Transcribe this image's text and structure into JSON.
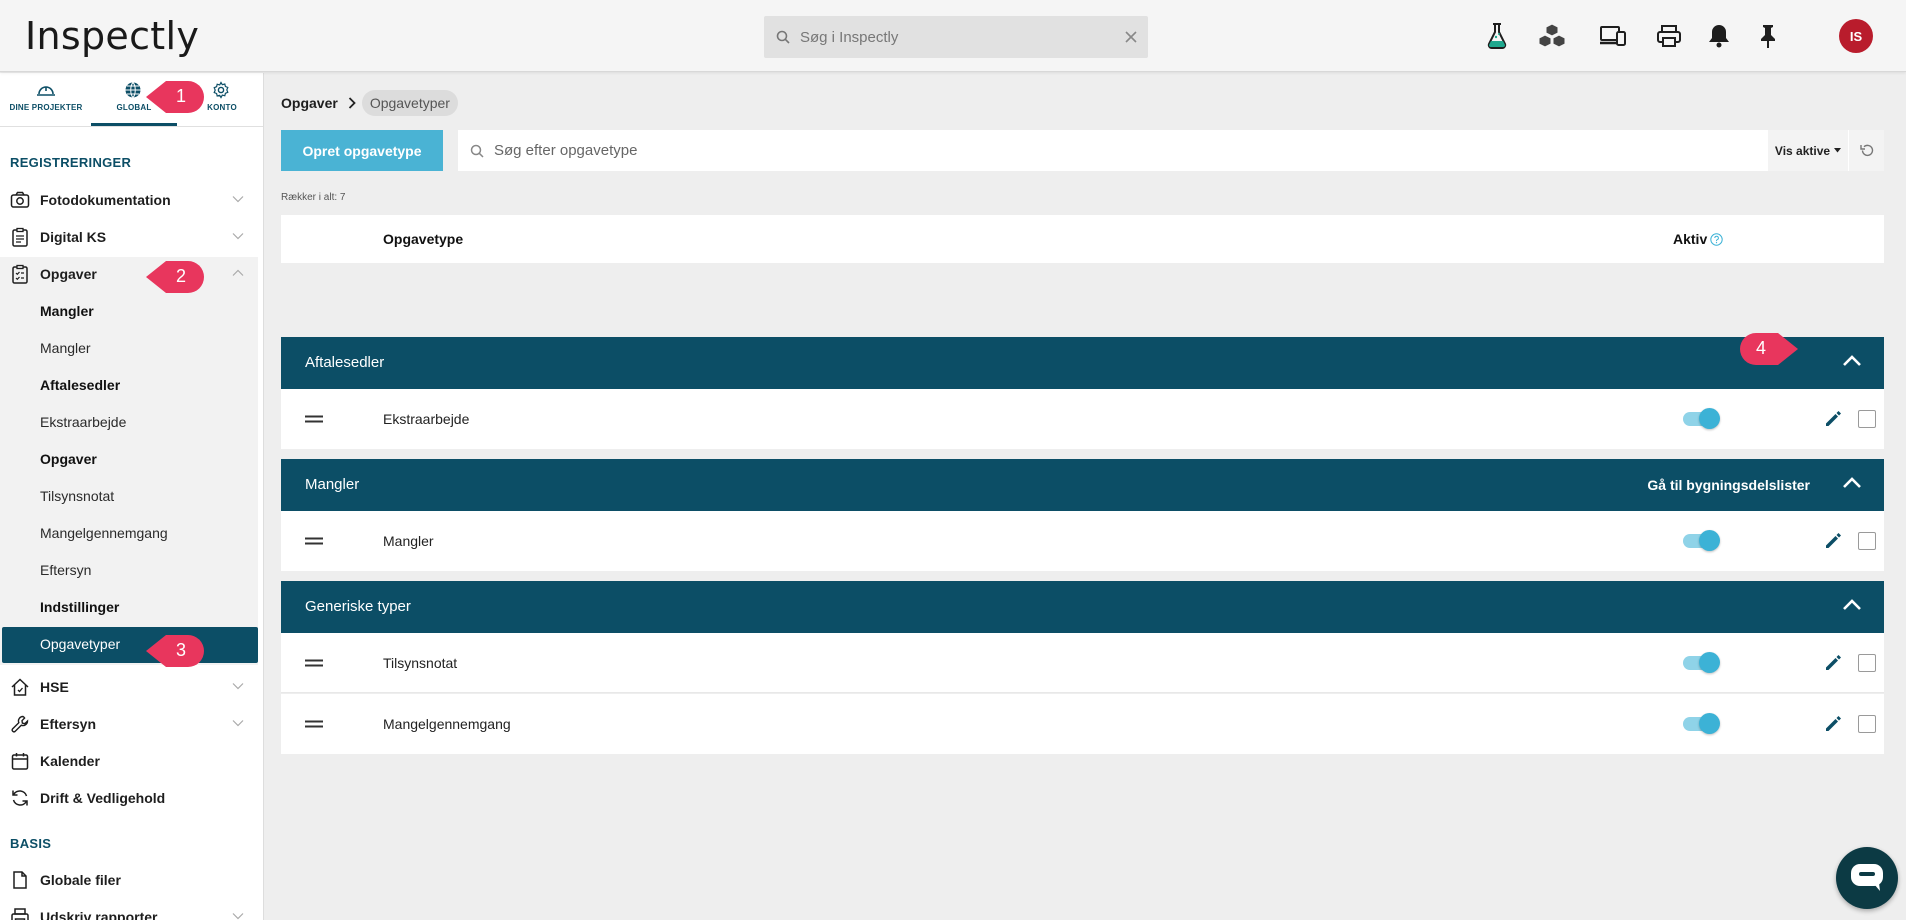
{
  "app": {
    "logo_text": "Inspectly"
  },
  "header": {
    "search_placeholder": "Søg i Inspectly",
    "avatar_initials": "IS",
    "icons": [
      "flask-icon",
      "cubes-icon",
      "devices-icon",
      "print-icon",
      "bell-icon",
      "pin-icon"
    ]
  },
  "sidebar": {
    "tabs": [
      {
        "label": "DINE PROJEKTER",
        "icon": "helmet-icon"
      },
      {
        "label": "GLOBAL",
        "icon": "globe-icon"
      },
      {
        "label": "KONTO",
        "icon": "gear-icon"
      }
    ],
    "sections": {
      "registreringer": "REGISTRERINGER",
      "basis": "BASIS"
    },
    "items": {
      "fotodokumentation": "Fotodokumentation",
      "digital_ks": "Digital KS",
      "opgaver": "Opgaver",
      "hse": "HSE",
      "eftersyn": "Eftersyn",
      "kalender": "Kalender",
      "drift": "Drift & Vedligehold",
      "globale_filer": "Globale filer",
      "udskriv_rapporter": "Udskriv rapporter"
    },
    "opgaver_sub": [
      {
        "label": "Mangler",
        "bold": true
      },
      {
        "label": "Mangler",
        "bold": false
      },
      {
        "label": "Aftalesedler",
        "bold": true
      },
      {
        "label": "Ekstraarbejde",
        "bold": false
      },
      {
        "label": "Opgaver",
        "bold": true
      },
      {
        "label": "Tilsynsnotat",
        "bold": false
      },
      {
        "label": "Mangelgennemgang",
        "bold": false
      },
      {
        "label": "Eftersyn",
        "bold": false
      },
      {
        "label": "Indstillinger",
        "bold": true
      }
    ],
    "active_sub": "Opgavetyper"
  },
  "main": {
    "breadcrumb": [
      "Opgaver",
      "Opgavetyper"
    ],
    "create_button": "Opret opgavetype",
    "search_placeholder": "Søg efter opgavetype",
    "filter_label": "Vis aktive",
    "row_count": "Rækker i alt: 7",
    "table": {
      "col_type": "Opgavetype",
      "col_aktiv": "Aktiv",
      "groups": [
        {
          "label": "Aftalesedler",
          "link": "",
          "rows": [
            {
              "label": "Ekstraarbejde",
              "active": true,
              "checked": false
            }
          ]
        },
        {
          "label": "Mangler",
          "link": "Gå til bygningsdelslister",
          "rows": [
            {
              "label": "Mangler",
              "active": true,
              "checked": false
            }
          ]
        },
        {
          "label": "Generiske typer",
          "link": "",
          "rows": [
            {
              "label": "Tilsynsnotat",
              "active": true,
              "checked": false
            },
            {
              "label": "Mangelgennemgang",
              "active": true,
              "checked": false
            }
          ]
        }
      ]
    }
  },
  "callouts": [
    "1",
    "2",
    "3",
    "4"
  ],
  "colors": {
    "primary": "#0c4e66",
    "accent": "#4ab3d4",
    "callout": "#e8365d",
    "avatar": "#b91c2c"
  }
}
